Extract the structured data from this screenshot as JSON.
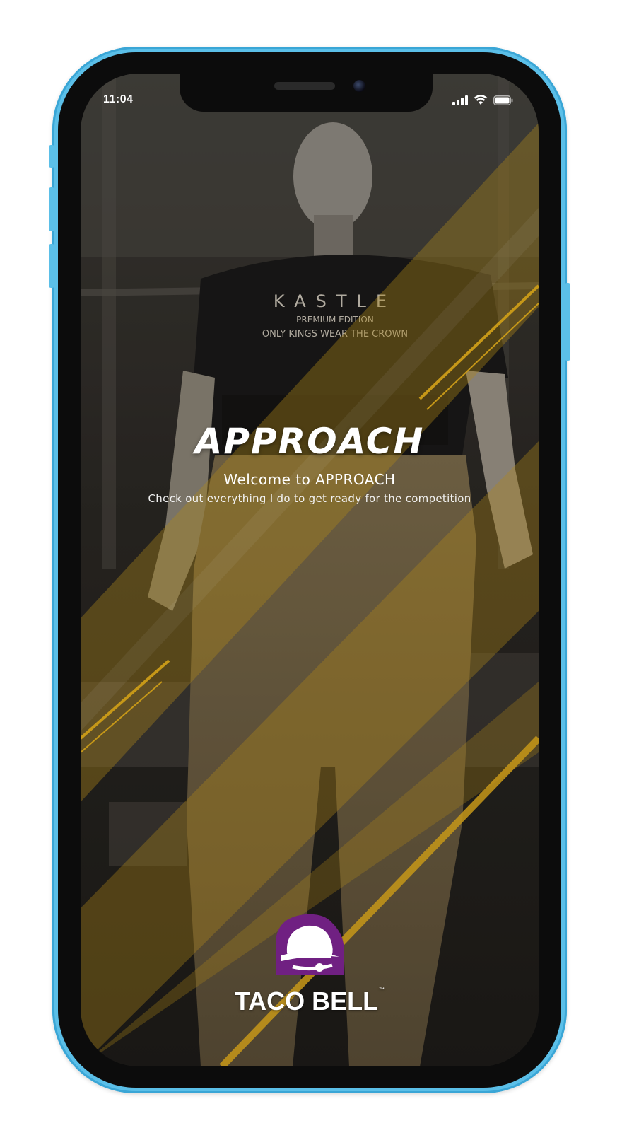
{
  "status_bar": {
    "time": "11:04",
    "icons": [
      "cellular-signal-icon",
      "wifi-icon",
      "battery-icon"
    ]
  },
  "hero": {
    "title": "APPROACH",
    "welcome": "Welcome to APPROACH",
    "tagline": "Check out everything I do to get ready for the competition"
  },
  "sponsor": {
    "name": "TACO BELL",
    "trademark": "™",
    "icon": "bell-logo-icon"
  },
  "colors": {
    "accent_gold": "#c99a1c",
    "brand_purple": "#702082",
    "device_frame": "#5bbfe8"
  }
}
